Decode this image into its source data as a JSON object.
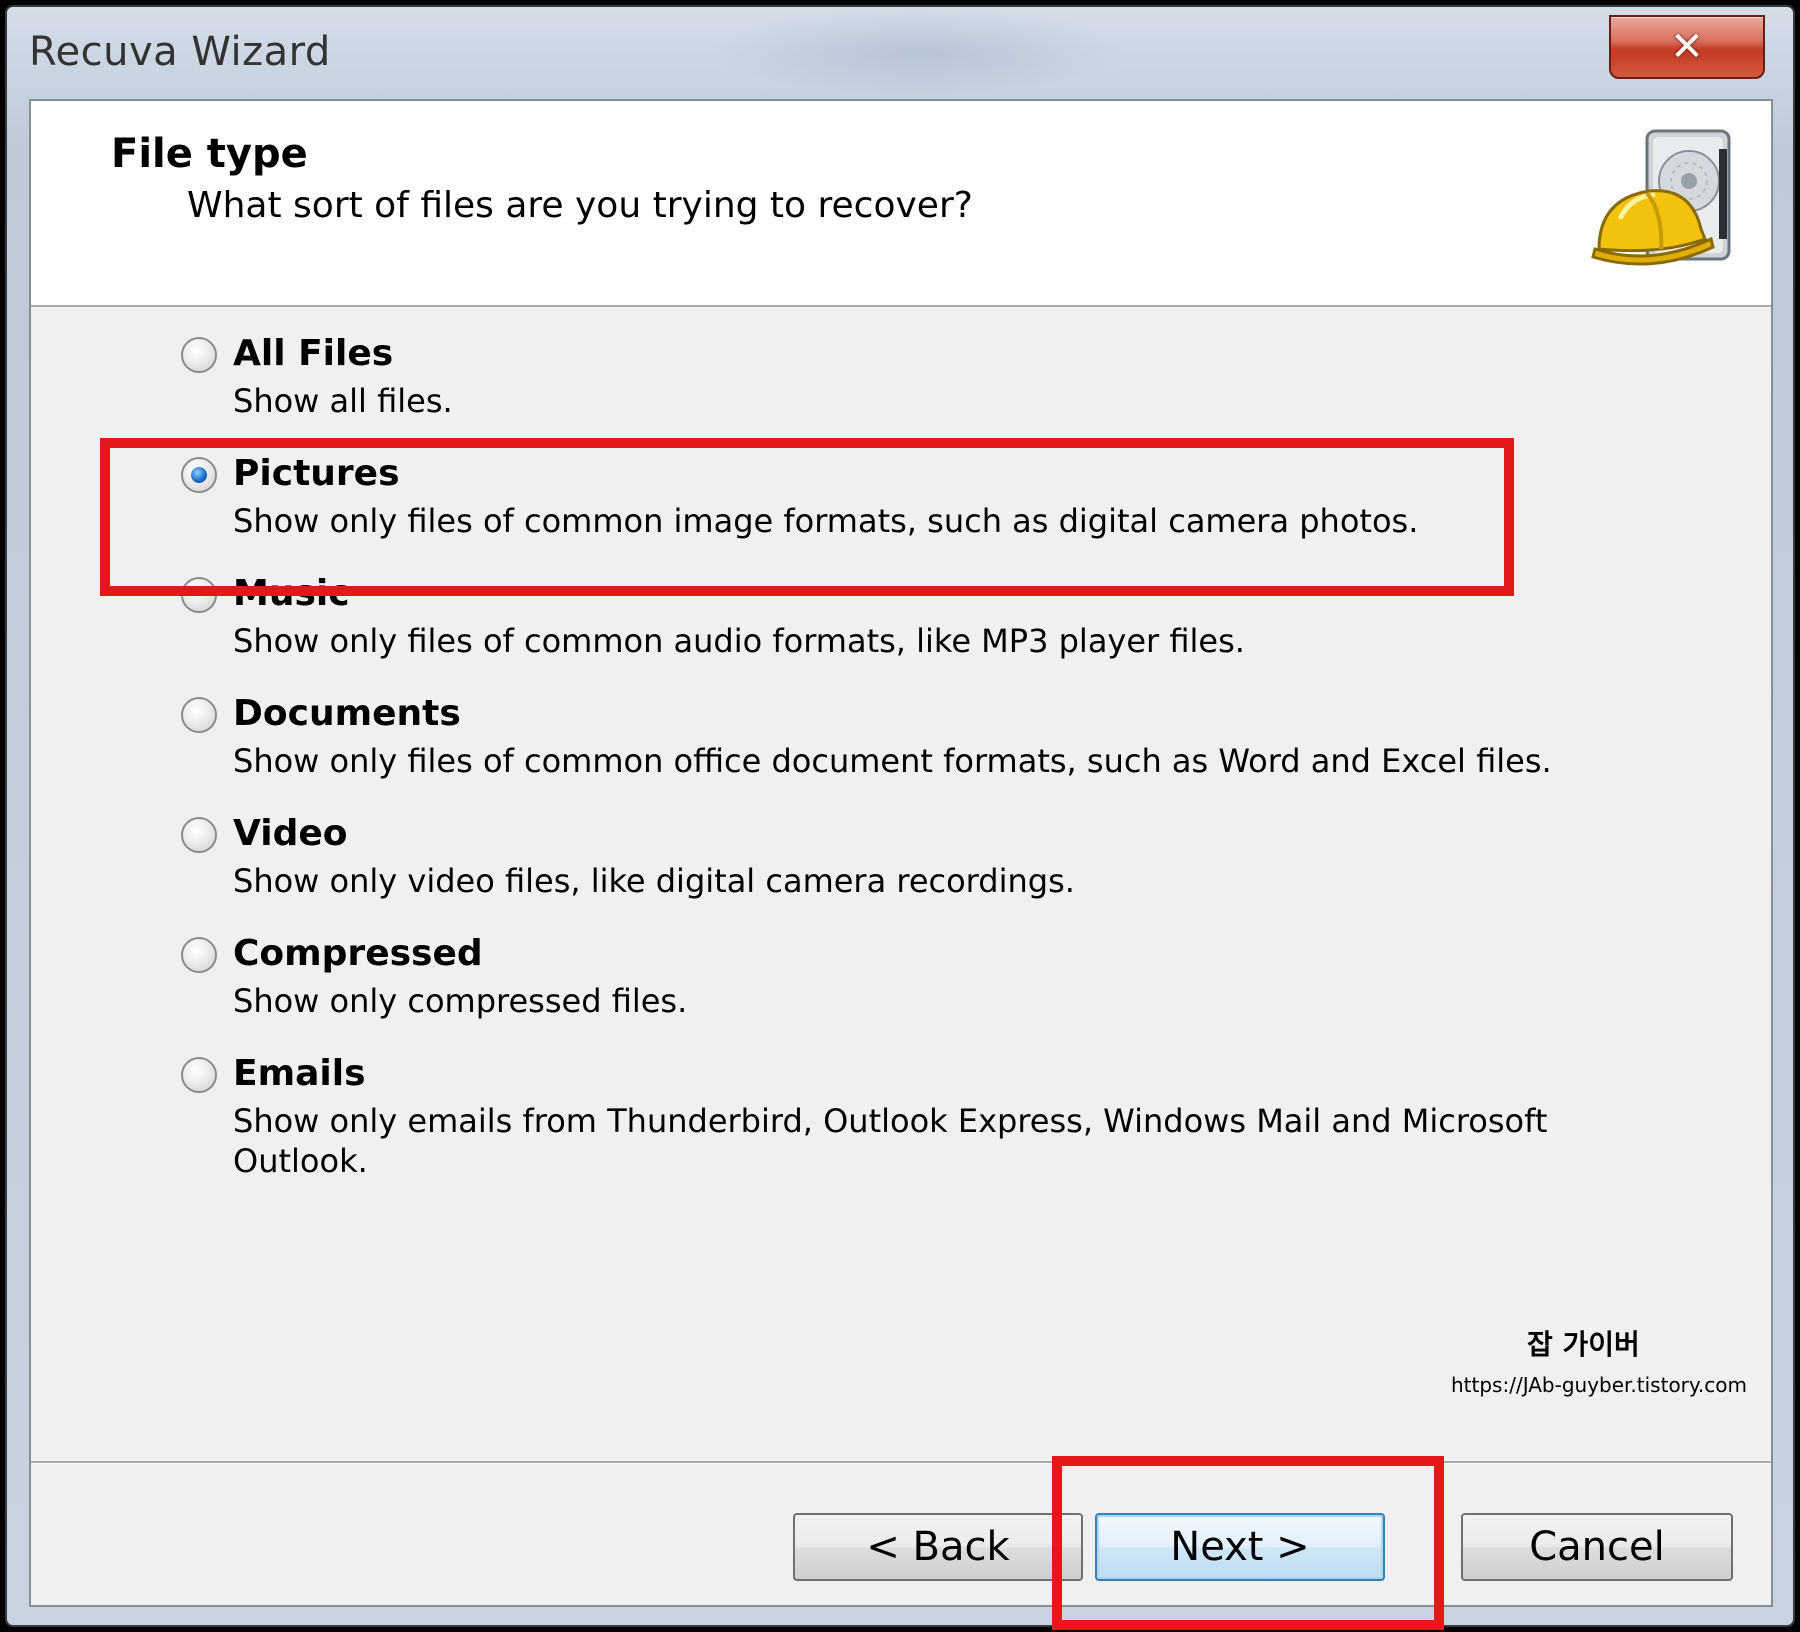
{
  "window": {
    "title": "Recuva Wizard",
    "close_symbol": "✕"
  },
  "header": {
    "title": "File type",
    "subtitle": "What sort of files are you trying to recover?",
    "logo_icon": "recuva-hardhat-drive-icon"
  },
  "options": [
    {
      "label": "All Files",
      "description": "Show all files.",
      "selected": false
    },
    {
      "label": "Pictures",
      "description": "Show only files of common image formats, such as digital camera photos.",
      "selected": true
    },
    {
      "label": "Music",
      "description": "Show only files of common audio formats, like MP3 player files.",
      "selected": false
    },
    {
      "label": "Documents",
      "description": "Show only files of common office document formats, such as Word and Excel files.",
      "selected": false
    },
    {
      "label": "Video",
      "description": "Show only video files, like digital camera recordings.",
      "selected": false
    },
    {
      "label": "Compressed",
      "description": "Show only compressed files.",
      "selected": false
    },
    {
      "label": "Emails",
      "description": "Show only emails from Thunderbird, Outlook Express, Windows Mail and Microsoft Outlook.",
      "selected": false
    }
  ],
  "watermark": {
    "name": "잡 가이버",
    "url": "https://JAb-guyber.tistory.com"
  },
  "buttons": {
    "back": "< Back",
    "next": "Next >",
    "cancel": "Cancel"
  },
  "colors": {
    "highlight": "#e5171b",
    "radio_selected": "#1d70c8",
    "close_button": "#c23a22"
  }
}
